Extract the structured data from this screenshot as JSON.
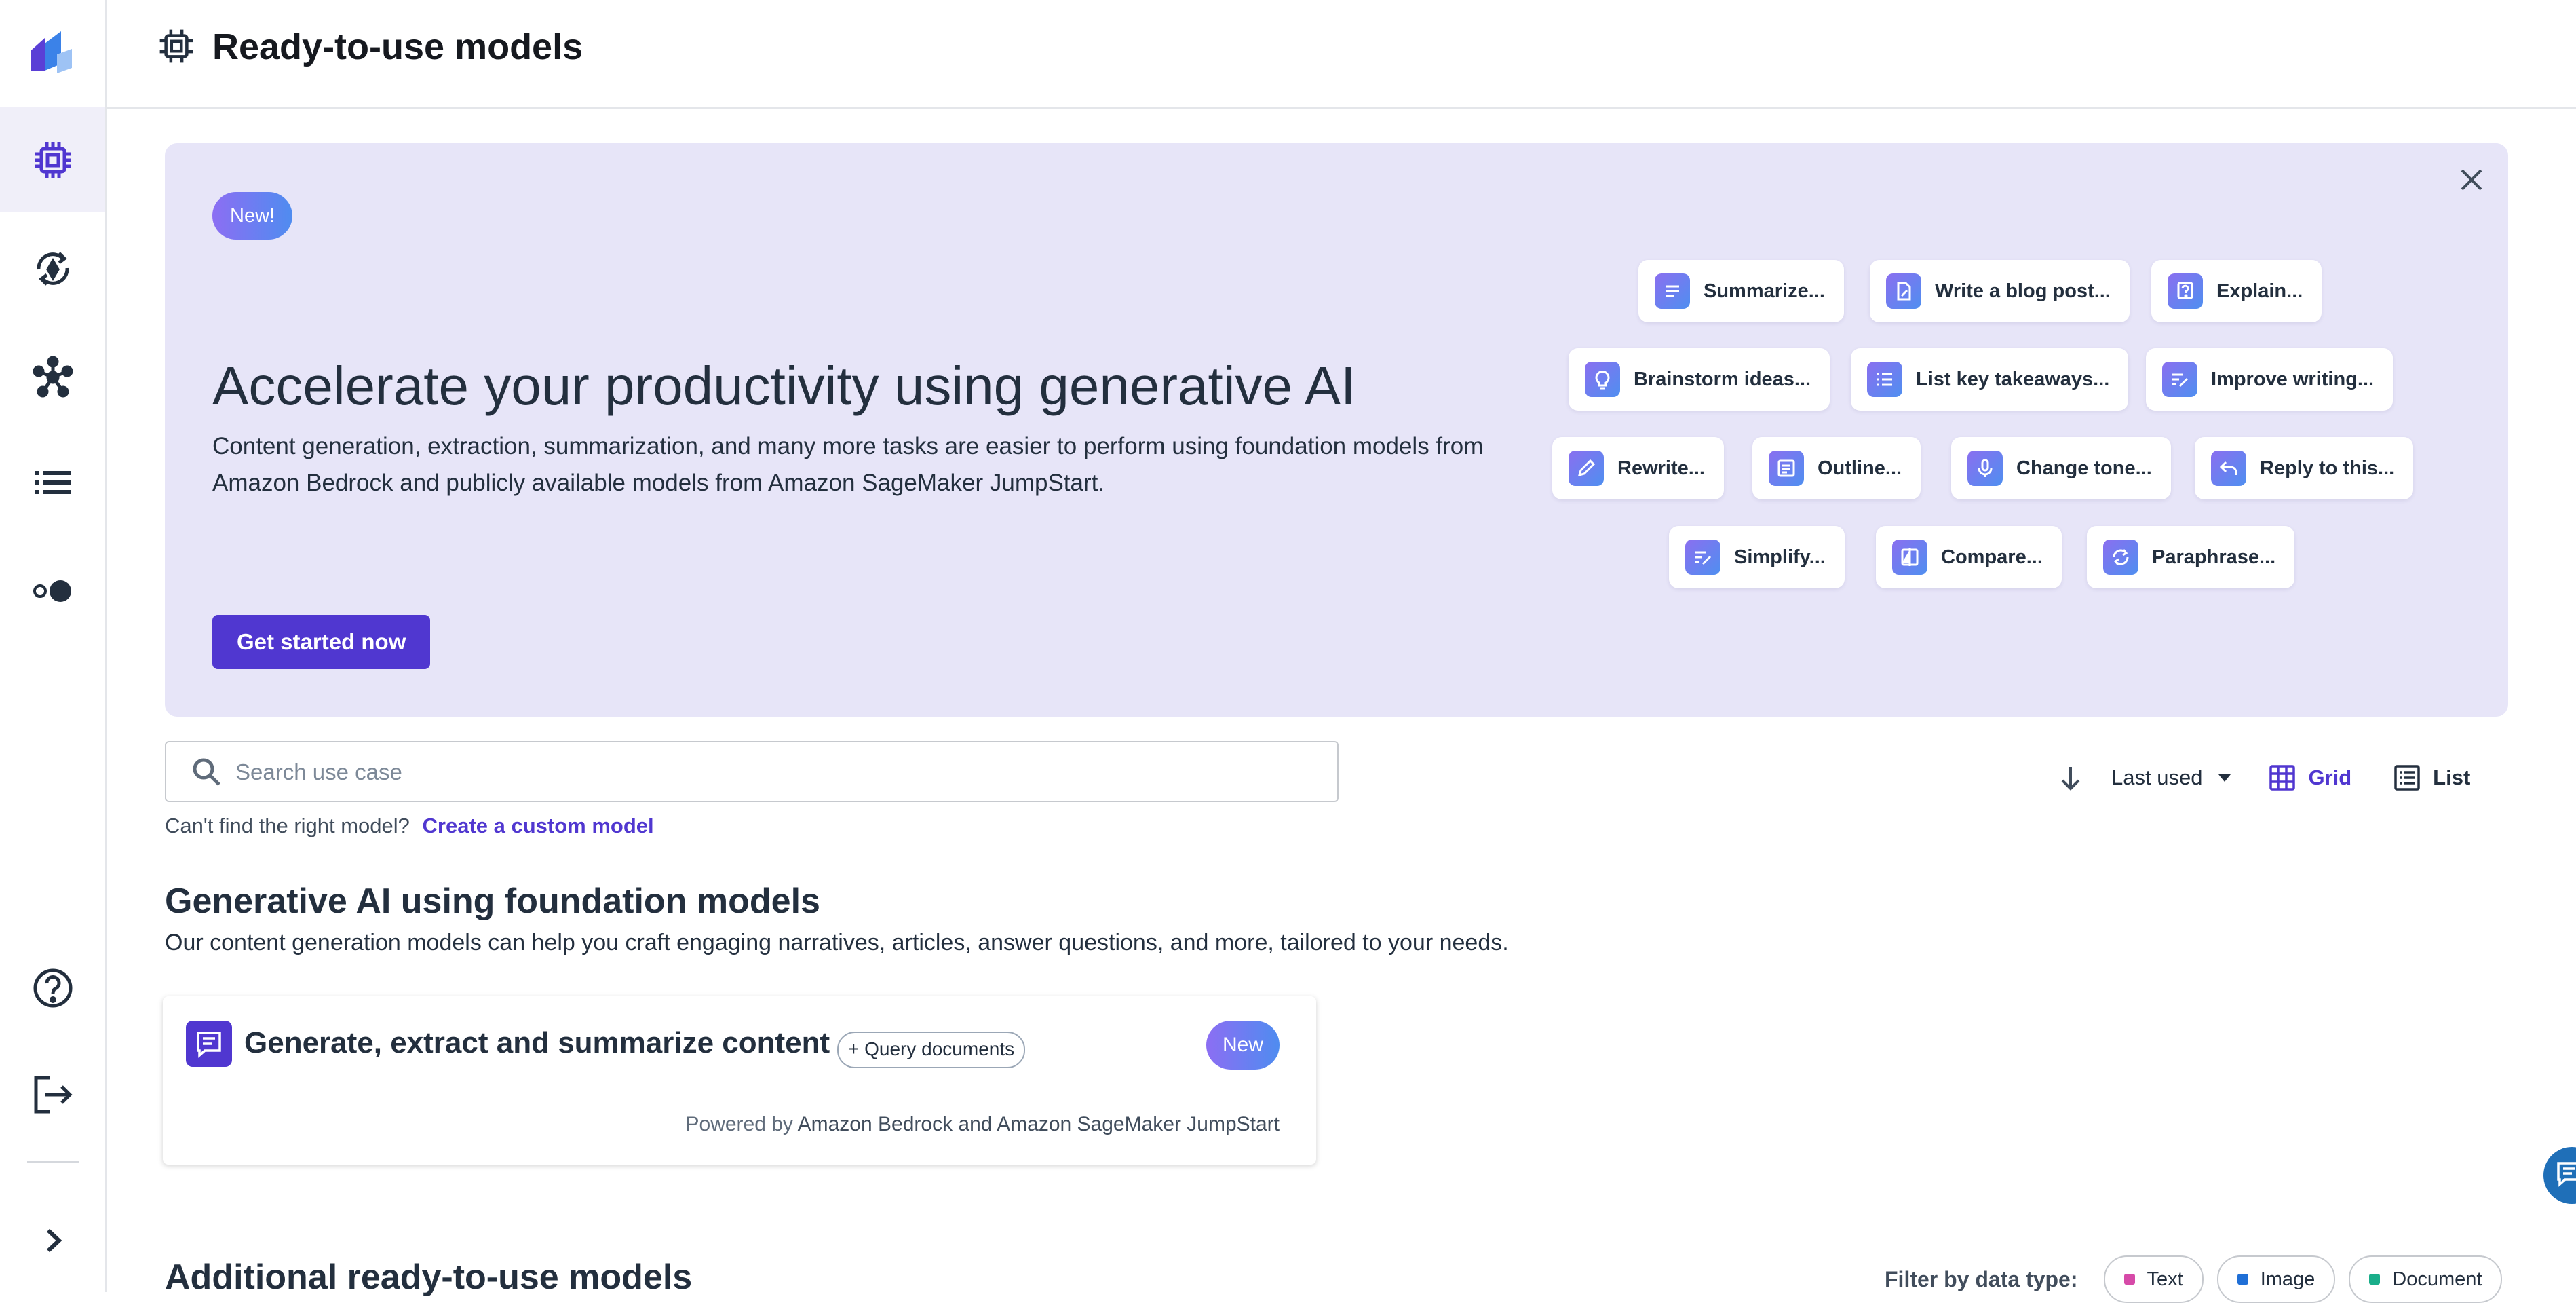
{
  "colors": {
    "accent": "#5037d0",
    "banner_bg": "#e7e5f8",
    "text_dot": "#d64aa8",
    "image_dot": "#1f6fd6",
    "document_dot": "#1aae8a"
  },
  "header": {
    "title": "Ready-to-use models",
    "title_icon": "chip-icon"
  },
  "sidebar": {
    "logo": "canvas-logo",
    "items": [
      {
        "icon": "chip-icon",
        "active": true
      },
      {
        "icon": "refresh-model-icon",
        "active": false
      },
      {
        "icon": "network-nodes-icon",
        "active": false
      },
      {
        "icon": "list-icon",
        "active": false
      },
      {
        "icon": "toggle-dots-icon",
        "active": false
      }
    ],
    "bottom_items": [
      {
        "icon": "help-icon"
      },
      {
        "icon": "sign-out-icon"
      },
      {
        "icon": "expand-chevron-icon"
      }
    ]
  },
  "banner": {
    "badge": "New!",
    "heading": "Accelerate your productivity using generative AI",
    "description": "Content generation, extraction, summarization, and many more tasks are easier to perform using foundation models from Amazon Bedrock and publicly available models from Amazon SageMaker JumpStart.",
    "cta": "Get started now",
    "close_icon": "close-icon",
    "chips": [
      {
        "label": "Summarize...",
        "icon": "lines-icon"
      },
      {
        "label": "Write a blog post...",
        "icon": "document-edit-icon"
      },
      {
        "label": "Explain...",
        "icon": "question-icon"
      },
      {
        "label": "Brainstorm ideas...",
        "icon": "lightbulb-icon"
      },
      {
        "label": "List key takeaways...",
        "icon": "bullet-list-icon"
      },
      {
        "label": "Improve writing...",
        "icon": "text-edit-icon"
      },
      {
        "label": "Rewrite...",
        "icon": "pencil-icon"
      },
      {
        "label": "Outline...",
        "icon": "outline-icon"
      },
      {
        "label": "Change tone...",
        "icon": "microphone-icon"
      },
      {
        "label": "Reply to this...",
        "icon": "reply-icon"
      },
      {
        "label": "Simplify...",
        "icon": "text-edit-icon"
      },
      {
        "label": "Compare...",
        "icon": "compare-icon"
      },
      {
        "label": "Paraphrase...",
        "icon": "cycle-icon"
      }
    ]
  },
  "search": {
    "placeholder": "Search use case",
    "value": ""
  },
  "helper": {
    "text": "Can't find the right model?",
    "link": "Create a custom model"
  },
  "sort": {
    "label": "Last used",
    "grid": "Grid",
    "list": "List"
  },
  "foundation": {
    "title": "Generative AI using foundation models",
    "description": "Our content generation models can help you craft engaging narratives, articles, answer questions, and more, tailored to your needs.",
    "card": {
      "title": "Generate, extract and summarize content",
      "tag": "+ Query documents",
      "badge": "New",
      "powered_prefix": "Powered by",
      "powered_by": "Amazon Bedrock and Amazon SageMaker JumpStart"
    }
  },
  "additional": {
    "title": "Additional ready-to-use models",
    "filter_label": "Filter by data type:",
    "filters": [
      "Text",
      "Image",
      "Document"
    ]
  }
}
